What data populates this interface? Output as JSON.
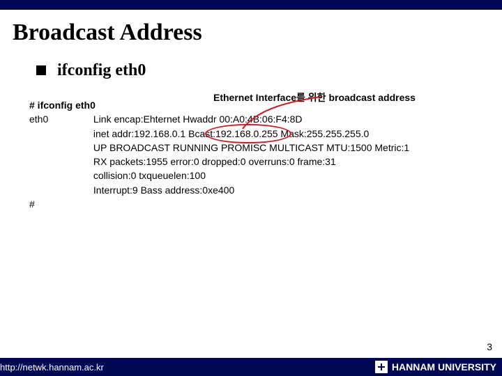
{
  "topbar": {},
  "title": "Broadcast Address",
  "subhead": {
    "label": "ifconfig eth0"
  },
  "caption": "Ethernet Interface를 위한 broadcast address",
  "code": {
    "cmd": "# ifconfig eth0",
    "iface": "eth0",
    "l1": "Link encap:Ehternet Hwaddr 00:A0:4B:06:F4:8D",
    "l2": "inet addr:192.168.0.1  Bcast:192.168.0.255  Mask:255.255.255.0",
    "l3": "UP BROADCAST RUNNING PROMISC MULTICAST  MTU:1500 Metric:1",
    "l4": "RX packets:1955 error:0 dropped:0 overruns:0 frame:31",
    "l5": "collision:0 txqueuelen:100",
    "l6": "Interrupt:9 Bass address:0xe400",
    "endprompt": "#"
  },
  "page_number": "3",
  "footer": {
    "url": "http://netwk.hannam.ac.kr",
    "org": "HANNAM UNIVERSITY"
  },
  "annotation": {
    "color": "#d8181c"
  }
}
